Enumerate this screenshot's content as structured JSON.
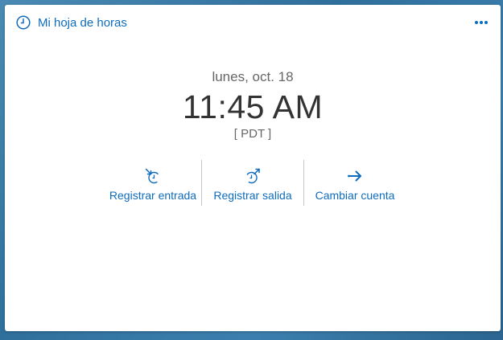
{
  "card": {
    "title": "Mi hoja de horas",
    "title_icon": "clock-icon",
    "menu_icon": "more-horizontal-icon"
  },
  "clock": {
    "date": "lunes, oct. 18",
    "time": "11:45 AM",
    "timezone": "[ PDT ]"
  },
  "actions": [
    {
      "label": "Registrar entrada",
      "icon": "clock-in-icon"
    },
    {
      "label": "Registrar salida",
      "icon": "clock-out-icon"
    },
    {
      "label": "Cambiar cuenta",
      "icon": "arrow-right-icon"
    }
  ],
  "colors": {
    "accent": "#0f6cbd",
    "text_primary": "#333333",
    "text_secondary": "#666666",
    "card_background": "#ffffff"
  }
}
